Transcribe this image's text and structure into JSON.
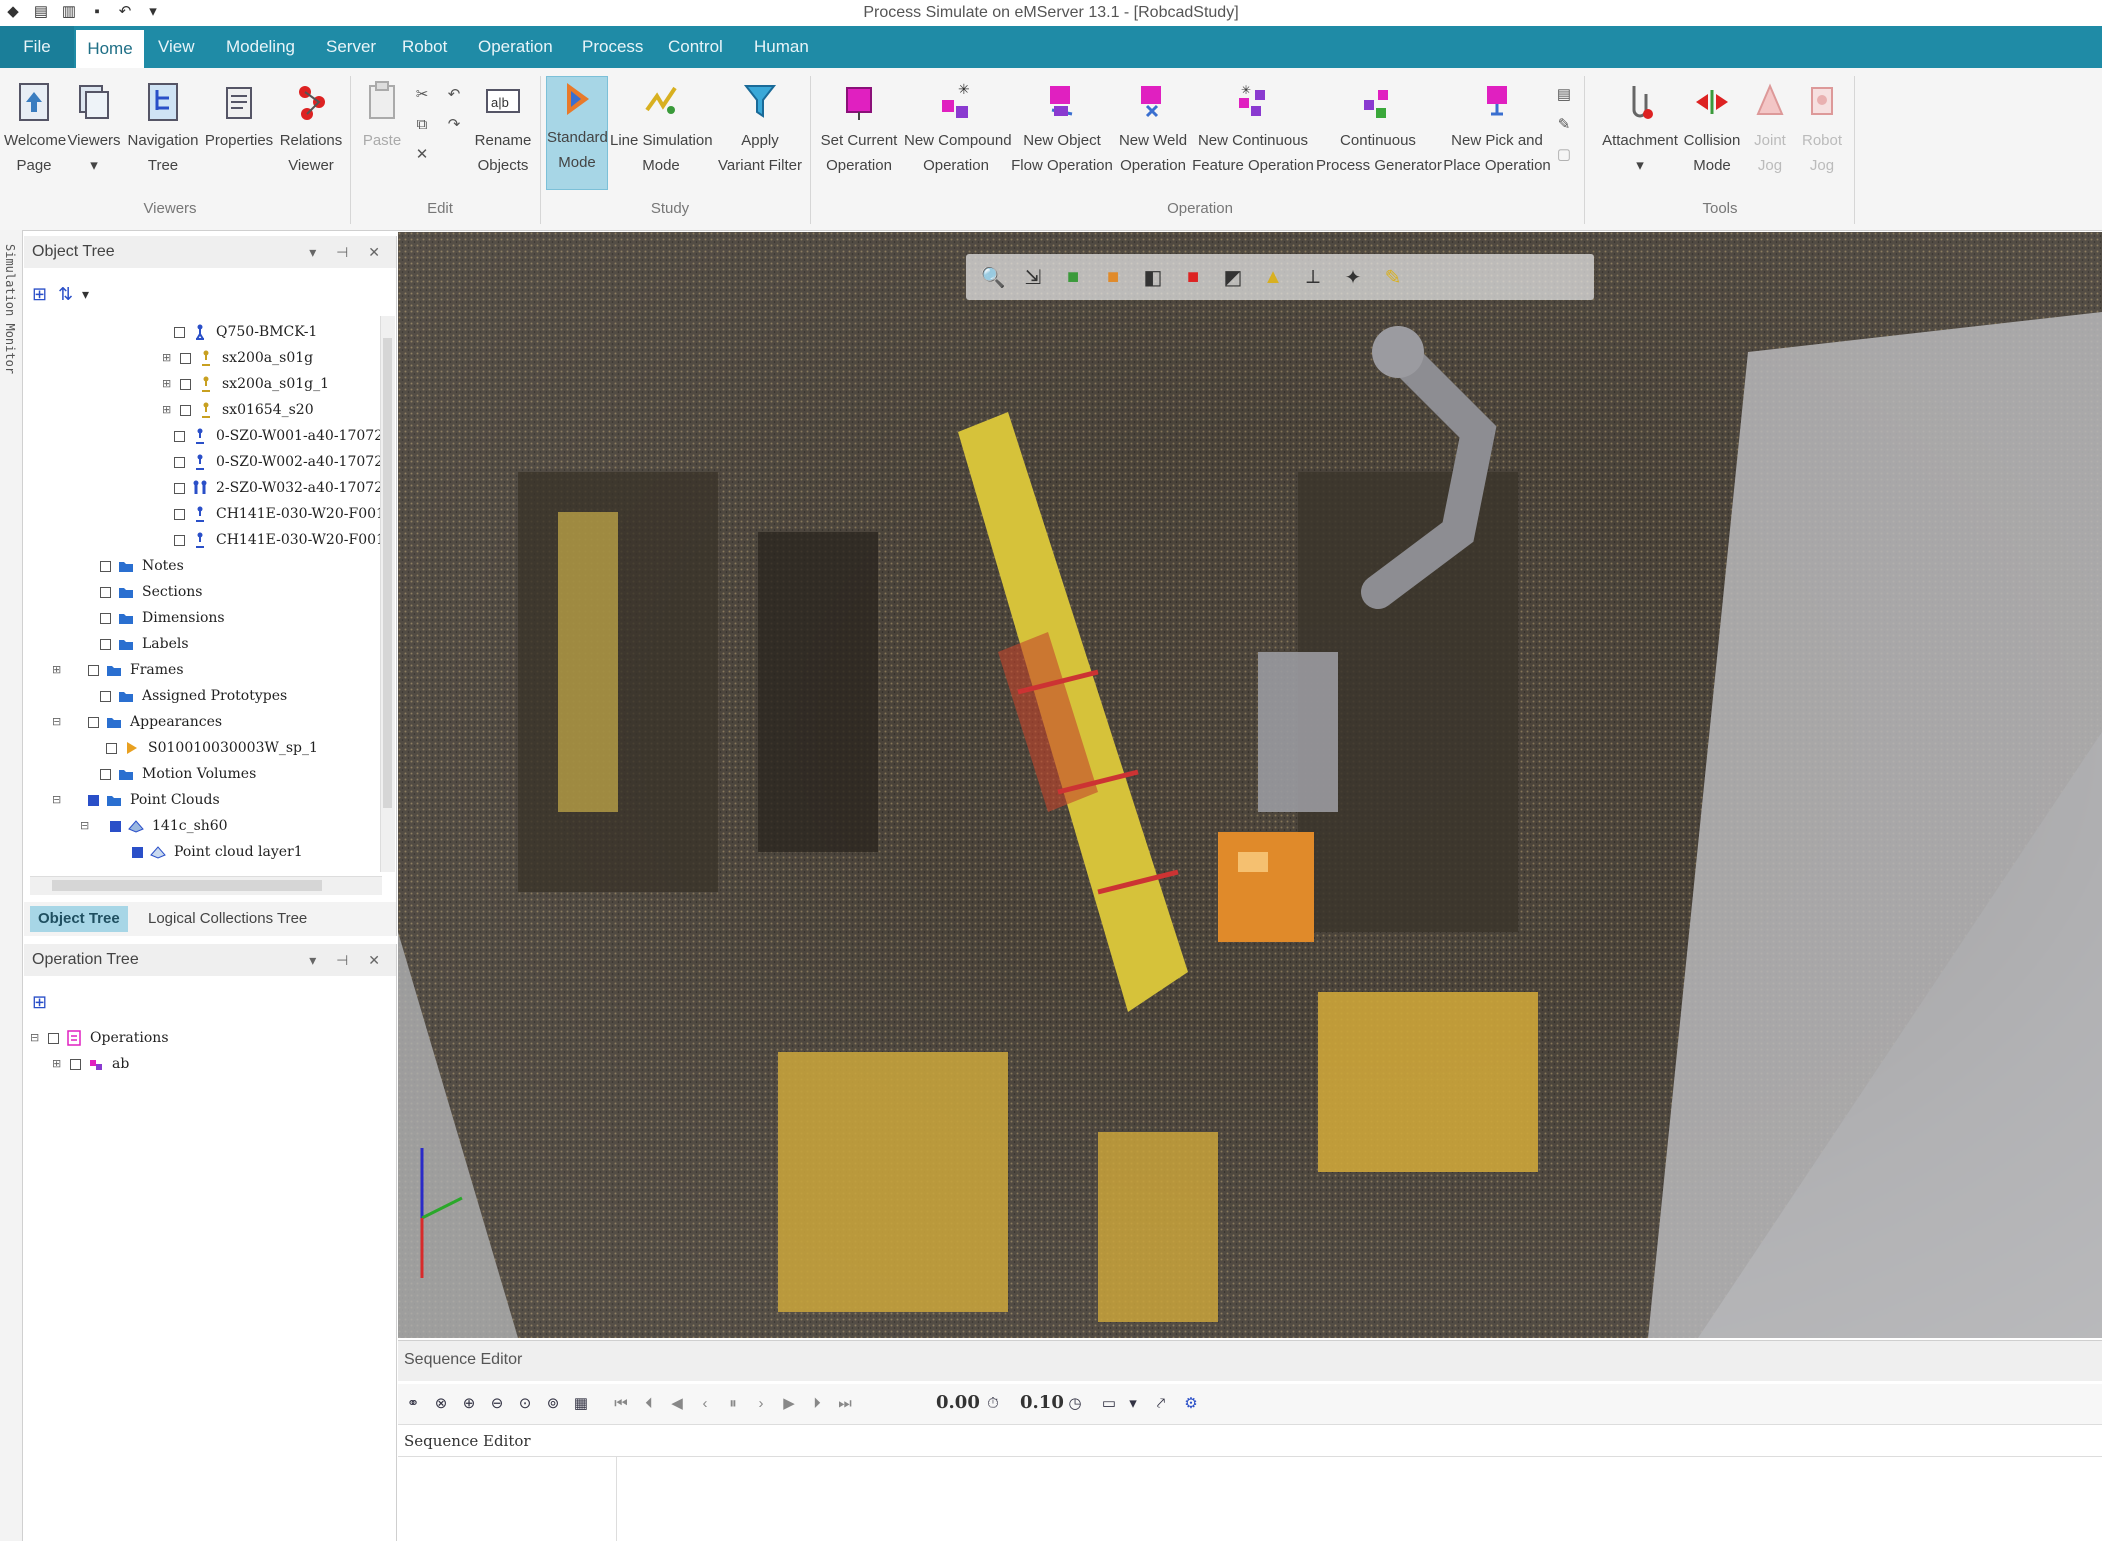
{
  "app": {
    "title": "Process Simulate on eMServer 13.1 - [RobcadStudy]"
  },
  "quick_access": [
    "app-menu-icon",
    "open-icon",
    "save-all-icon",
    "save-icon",
    "undo-icon",
    "dropdown-icon"
  ],
  "tabs": [
    "File",
    "Home",
    "View",
    "Modeling",
    "Server",
    "Robot",
    "Operation",
    "Process",
    "Control",
    "Human"
  ],
  "ribbon": {
    "viewers": {
      "welcome_l1": "Welcome",
      "welcome_l2": "Page",
      "viewers_l1": "Viewers",
      "navigation_l1": "Navigation",
      "navigation_l2": "Tree",
      "properties_l1": "Properties",
      "relations_l1": "Relations",
      "relations_l2": "Viewer",
      "group": "Viewers"
    },
    "edit": {
      "paste_l1": "Paste",
      "rename_l1": "Rename",
      "rename_l2": "Objects",
      "group": "Edit"
    },
    "study": {
      "standard_l1": "Standard",
      "standard_l2": "Mode",
      "linesim_l1": "Line Simulation",
      "linesim_l2": "Mode",
      "variant_l1": "Apply",
      "variant_l2": "Variant Filter",
      "group": "Study"
    },
    "operation": {
      "setcurrent_l1": "Set Current",
      "setcurrent_l2": "Operation",
      "compound_l1": "New Compound",
      "compound_l2": "Operation",
      "objflow_l1": "New Object",
      "objflow_l2": "Flow Operation",
      "weld_l1": "New Weld",
      "weld_l2": "Operation",
      "contfeature_l1": "New Continuous",
      "contfeature_l2": "Feature Operation",
      "contproc_l1": "Continuous",
      "contproc_l2": "Process Generator",
      "pickplace_l1": "New Pick and",
      "pickplace_l2": "Place Operation",
      "group": "Operation"
    },
    "tools": {
      "attachment_l1": "Attachment",
      "collision_l1": "Collision",
      "collision_l2": "Mode",
      "jointjog_l1": "Joint",
      "jointjog_l2": "Jog",
      "robotjog_l1": "Robot",
      "robotjog_l2": "Jog",
      "group": "Tools"
    }
  },
  "left_strip": {
    "label": "Simulation Monitor"
  },
  "object_tree": {
    "title": "Object Tree",
    "items": [
      {
        "label": "Q750-BMCK-1"
      },
      {
        "label": "sx200a_s01g"
      },
      {
        "label": "sx200a_s01g_1"
      },
      {
        "label": "sx01654_s20"
      },
      {
        "label": "0-SZ0-W001-a40-17072"
      },
      {
        "label": "0-SZ0-W002-a40-17072"
      },
      {
        "label": "2-SZ0-W032-a40-17072"
      },
      {
        "label": "CH141E-030-W20-F001-"
      },
      {
        "label": "CH141E-030-W20-F001-"
      },
      {
        "label": "Notes"
      },
      {
        "label": "Sections"
      },
      {
        "label": "Dimensions"
      },
      {
        "label": "Labels"
      },
      {
        "label": "Frames"
      },
      {
        "label": "Assigned Prototypes"
      },
      {
        "label": "Appearances"
      },
      {
        "label": "S010010030003W_sp_1"
      },
      {
        "label": "Motion Volumes"
      },
      {
        "label": "Point Clouds"
      },
      {
        "label": "141c_sh60"
      },
      {
        "label": "Point cloud layer1"
      }
    ],
    "tabs": [
      "Object Tree",
      "Logical Collections Tree"
    ]
  },
  "operation_tree": {
    "title": "Operation Tree",
    "items": [
      {
        "label": "Operations"
      },
      {
        "label": "ab"
      }
    ]
  },
  "sequence_editor": {
    "title": "Sequence Editor",
    "column_header": "Sequence Editor",
    "time_value": "0.00",
    "step_value": "0.10"
  },
  "colors": {
    "accent": "#1f8ba6",
    "active_button": "#a7d6e6"
  }
}
